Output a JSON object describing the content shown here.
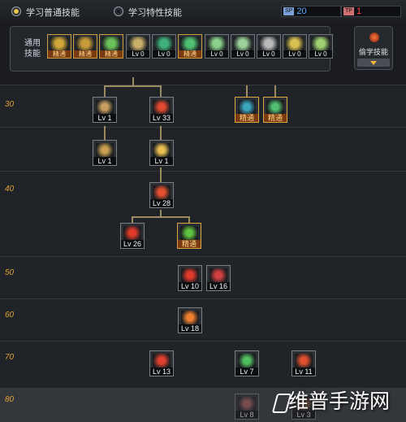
{
  "tabs": [
    {
      "label": "学习普通技能",
      "selected": true
    },
    {
      "label": "学习特性技能",
      "selected": false
    }
  ],
  "points": [
    {
      "tag": "SP",
      "value": "20",
      "tag_color": "#7aa0d8",
      "value_color": "#58a8ff"
    },
    {
      "tag": "TP",
      "value": "1",
      "tag_color": "#d07070",
      "value_color": "#ff4a4a"
    }
  ],
  "common_skills": {
    "label": "通用技能",
    "items": [
      {
        "name": "running-figure-icon",
        "badge": "精通",
        "learned": true,
        "color": "#d2a73a"
      },
      {
        "name": "kick-icon",
        "badge": "精通",
        "learned": true,
        "color": "#c79a3a"
      },
      {
        "name": "dash-icon",
        "badge": "精通",
        "learned": true,
        "color": "#6bc05a"
      },
      {
        "name": "wings-icon",
        "badge": "Lv 0",
        "learned": false,
        "color": "#c9b06a"
      },
      {
        "name": "green-burst-icon",
        "badge": "Lv 0",
        "learned": false,
        "color": "#3fb07a"
      },
      {
        "name": "green-star-icon",
        "badge": "精通",
        "learned": true,
        "color": "#4fc070"
      },
      {
        "name": "crouch-figure-icon",
        "badge": "Lv 0",
        "learned": false,
        "color": "#8ad08a"
      },
      {
        "name": "leap-figure-icon",
        "badge": "Lv 0",
        "learned": false,
        "color": "#9ad09a"
      },
      {
        "name": "shield-icon",
        "badge": "Lv 0",
        "learned": false,
        "color": "#b9b9b9"
      },
      {
        "name": "strength-icon",
        "badge": "Lv 0",
        "learned": false,
        "color": "#d8c050"
      },
      {
        "name": "arrow-icon",
        "badge": "Lv 0",
        "learned": false,
        "color": "#9fd070"
      }
    ]
  },
  "steal_skill": {
    "label": "偷学技能"
  },
  "levels": [
    "30",
    "40",
    "50",
    "60",
    "70",
    "80"
  ],
  "tree_skills": [
    {
      "name": "bow-skill-icon",
      "badge": "Lv 1",
      "learned": false,
      "color": "#c7a060"
    },
    {
      "name": "red-strike-icon",
      "badge": "Lv 33",
      "learned": false,
      "color": "#e24a30"
    },
    {
      "name": "blue-orb-icon",
      "badge": "精通",
      "learned": true,
      "color": "#3aa6c0"
    },
    {
      "name": "green-blade-icon",
      "badge": "精通",
      "learned": true,
      "color": "#50c070"
    },
    {
      "name": "multi-arrow-icon",
      "badge": "Lv 1",
      "learned": false,
      "color": "#c8a050"
    },
    {
      "name": "explosion-icon",
      "badge": "Lv 1",
      "learned": false,
      "color": "#e8c050"
    },
    {
      "name": "fire-blast-icon",
      "badge": "Lv 28",
      "learned": false,
      "color": "#e25030"
    },
    {
      "name": "flame-burst-icon",
      "badge": "Lv 26",
      "learned": false,
      "color": "#e03a2a"
    },
    {
      "name": "green-dragon-icon",
      "badge": "精通",
      "learned": true,
      "color": "#60c040"
    },
    {
      "name": "fire-ring-icon",
      "badge": "Lv 10",
      "learned": false,
      "color": "#e03a2a"
    },
    {
      "name": "crosshair-icon",
      "badge": "Lv 16",
      "learned": false,
      "color": "#d04040"
    },
    {
      "name": "sunburst-icon",
      "badge": "Lv 18",
      "learned": false,
      "color": "#f08030"
    },
    {
      "name": "red-slash-icon",
      "badge": "Lv 13",
      "learned": false,
      "color": "#e04030"
    },
    {
      "name": "green-spark-icon",
      "badge": "Lv 7",
      "learned": false,
      "color": "#50c060"
    },
    {
      "name": "red-explosion-icon",
      "badge": "Lv 11",
      "learned": false,
      "color": "#e05030"
    },
    {
      "name": "faded-skill-icon",
      "badge": "Lv 8",
      "learned": false,
      "color": "#b06060"
    },
    {
      "name": "faded-skill-icon",
      "badge": "Lv 3",
      "learned": false,
      "color": "#b07050"
    }
  ],
  "watermark": "维普手游网"
}
